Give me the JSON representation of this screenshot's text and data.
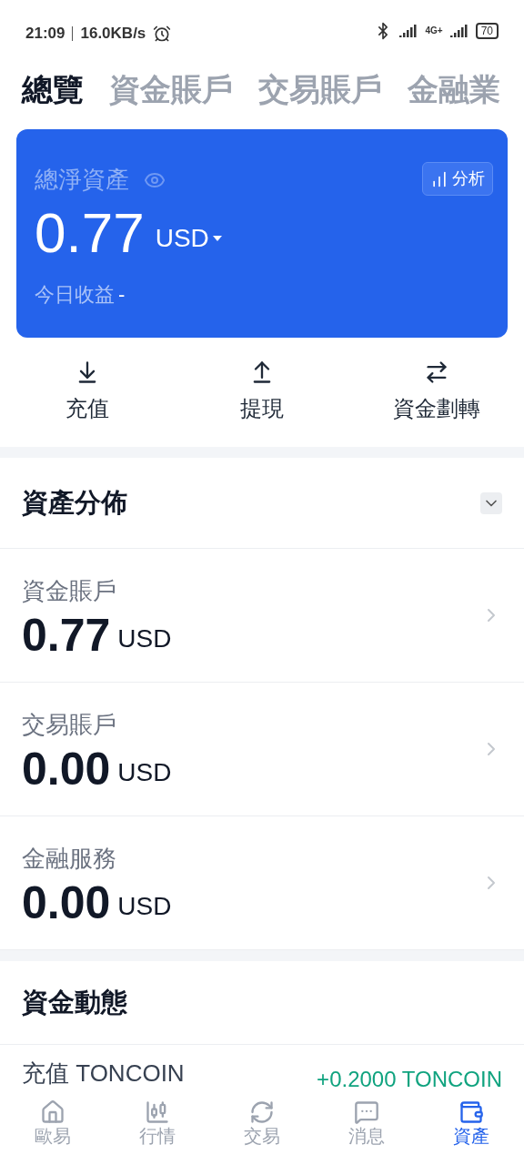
{
  "status_bar": {
    "time": "21:09",
    "speed": "16.0KB/s",
    "network": "4G+",
    "battery": "70"
  },
  "tabs": [
    {
      "label": "總覽",
      "selected": true
    },
    {
      "label": "資金賬戶",
      "selected": false
    },
    {
      "label": "交易賬戶",
      "selected": false
    },
    {
      "label": "金融業",
      "selected": false
    }
  ],
  "summary": {
    "title": "總淨資產",
    "amount": "0.77",
    "currency": "USD",
    "analysis_button": "分析",
    "today_label": "今日收益",
    "today_value": "-"
  },
  "actions": [
    {
      "label": "充值",
      "kind": "deposit"
    },
    {
      "label": "提現",
      "kind": "withdraw"
    },
    {
      "label": "資金劃轉",
      "kind": "transfer"
    }
  ],
  "distribution": {
    "title": "資產分佈",
    "accounts": [
      {
        "name": "資金賬戶",
        "amount": "0.77",
        "currency": "USD"
      },
      {
        "name": "交易賬戶",
        "amount": "0.00",
        "currency": "USD"
      },
      {
        "name": "金融服務",
        "amount": "0.00",
        "currency": "USD"
      }
    ]
  },
  "activity": {
    "title": "資金動態",
    "items": [
      {
        "label": "充值 TONCOIN",
        "amount": "+0.2000 TONCOIN"
      }
    ]
  },
  "bottom_nav": [
    {
      "label": "歐易",
      "kind": "home",
      "selected": false
    },
    {
      "label": "行情",
      "kind": "market",
      "selected": false
    },
    {
      "label": "交易",
      "kind": "trade",
      "selected": false
    },
    {
      "label": "消息",
      "kind": "message",
      "selected": false
    },
    {
      "label": "資產",
      "kind": "wallet",
      "selected": true
    }
  ]
}
